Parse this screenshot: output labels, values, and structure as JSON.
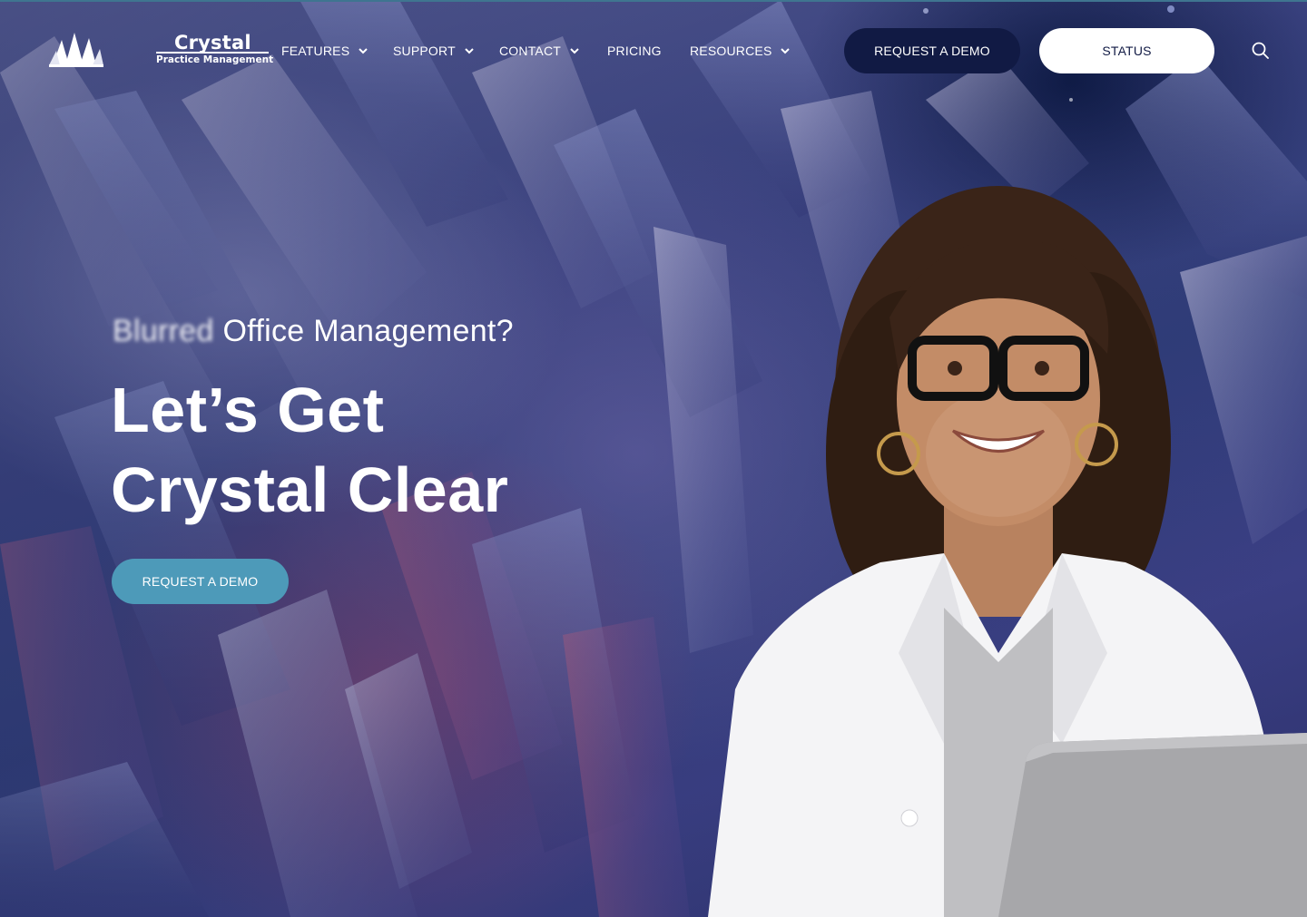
{
  "brand": {
    "name": "Crystal",
    "subtitle": "Practice Management"
  },
  "nav": {
    "items": [
      {
        "label": "FEATURES",
        "has_dropdown": true
      },
      {
        "label": "SUPPORT",
        "has_dropdown": true
      },
      {
        "label": "CONTACT",
        "has_dropdown": true
      },
      {
        "label": "PRICING",
        "has_dropdown": false
      },
      {
        "label": "RESOURCES",
        "has_dropdown": true
      }
    ],
    "demo_button": "REQUEST A DEMO",
    "status_button": "STATUS",
    "search_icon": "search-icon"
  },
  "hero": {
    "tagline_blur": "Blurred",
    "tagline_rest": " Office Management?",
    "headline_line1": "Let’s Get",
    "headline_line2": "Crystal Clear",
    "cta": "REQUEST A DEMO"
  },
  "colors": {
    "nav_demo_bg": "#111a44",
    "status_bg": "#ffffff",
    "cta_bg": "#4d9ab9",
    "text": "#ffffff"
  }
}
